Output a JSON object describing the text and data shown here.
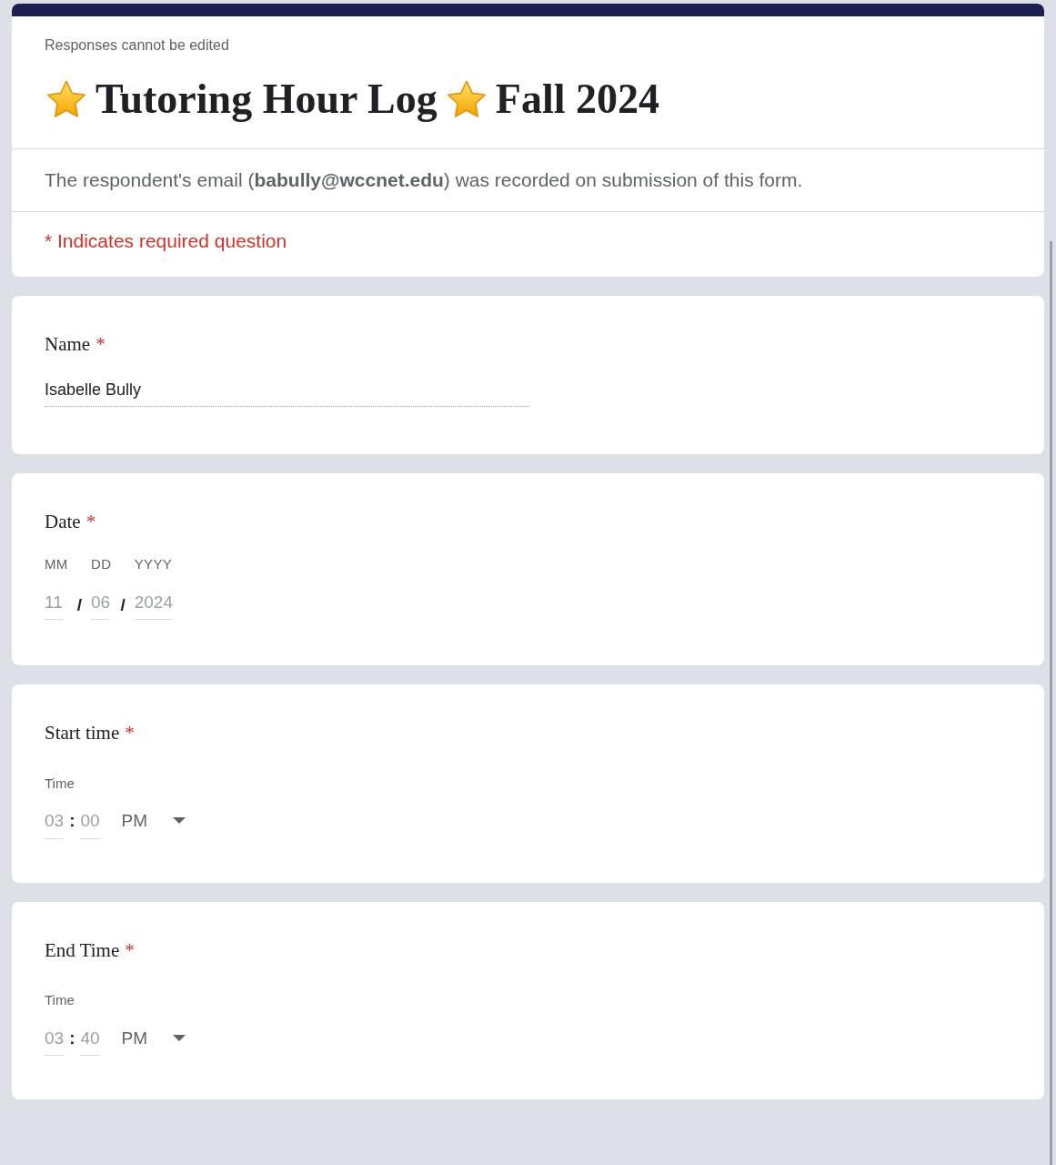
{
  "header": {
    "notice": "Responses cannot be edited",
    "title_parts": [
      "Tutoring Hour Log",
      "Fall 2024"
    ],
    "email_note": "The respondent's email (**babully@wccnet.edu**) was recorded on submission of this form.",
    "required_note": "* Indicates required question"
  },
  "questions": [
    {
      "kind": "text",
      "label": "Name",
      "required_mark": "*",
      "value": "Isabelle Bully"
    },
    {
      "kind": "date",
      "label": "Date",
      "required_mark": "*",
      "parts": [
        {
          "caption": "MM",
          "value": "11"
        },
        {
          "caption": "DD",
          "value": "06"
        },
        {
          "caption": "YYYY",
          "value": "2024"
        }
      ],
      "separators": [
        "/",
        "/"
      ]
    },
    {
      "kind": "time",
      "label": "Start time",
      "required_mark": "*",
      "caption": "Time",
      "hour": "03",
      "separator": ":",
      "minute": "00",
      "period": "PM"
    },
    {
      "kind": "time",
      "label": "End Time",
      "required_mark": "*",
      "caption": "Time",
      "hour": "03",
      "separator": ":",
      "minute": "40",
      "period": "PM"
    }
  ]
}
